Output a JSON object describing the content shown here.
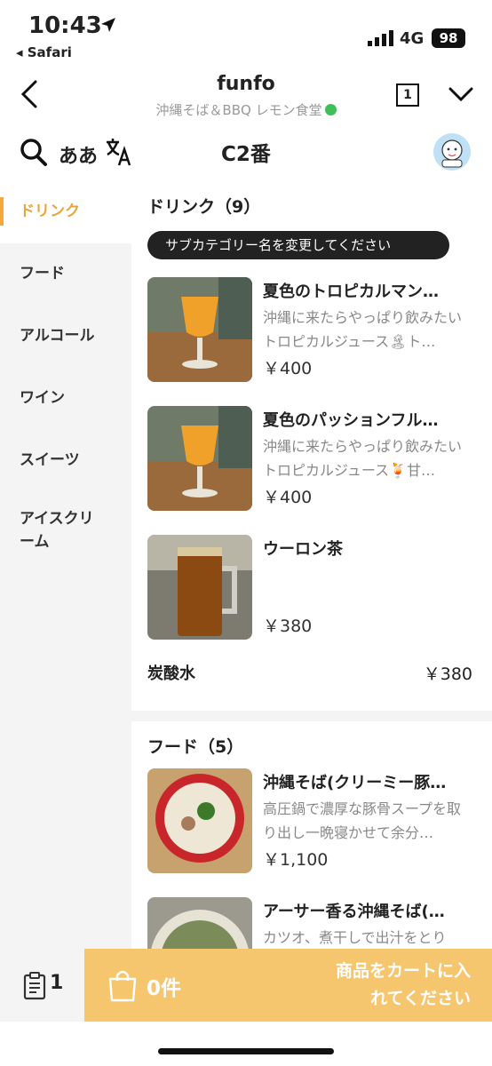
{
  "status": {
    "time": "10:43",
    "back_app": "◂ Safari",
    "network": "4G",
    "battery": "98"
  },
  "header": {
    "title": "funfo",
    "subtitle": "沖縄そば＆BBQ レモン食堂",
    "tab_count": "1"
  },
  "toolbar": {
    "kana_label": "ああ",
    "table_name": "C2番"
  },
  "sidebar": {
    "items": [
      {
        "label": "ドリンク"
      },
      {
        "label": "フード"
      },
      {
        "label": "アルコール"
      },
      {
        "label": "ワイン"
      },
      {
        "label": "スイーツ"
      },
      {
        "label": "アイスクリーム"
      }
    ]
  },
  "drinks": {
    "title": "ドリンク（9）",
    "subcategory_pill": "サブカテゴリー名を変更してください",
    "items": [
      {
        "name": "夏色のトロピカルマン…",
        "desc": "沖縄に来たらやっぱり飲みたいトロピカルジュース🏝ト…",
        "price": "￥400"
      },
      {
        "name": "夏色のパッションフル…",
        "desc": "沖縄に来たらやっぱり飲みたいトロピカルジュース🍹甘…",
        "price": "￥400"
      },
      {
        "name": "ウーロン茶",
        "desc": "",
        "price": "￥380"
      }
    ],
    "plain_item": {
      "name": "炭酸水",
      "price": "￥380"
    }
  },
  "food": {
    "title": "フード（5）",
    "items": [
      {
        "name": "沖縄そば(クリーミー豚…",
        "desc": "高圧鍋で濃厚な豚骨スープを取り出し一晩寝かせて余分…",
        "price": "￥1,100"
      },
      {
        "name": "アーサー香る沖縄そば(…",
        "desc": "カツオ、煮干しで出汁をとり",
        "price": ""
      }
    ]
  },
  "bottom": {
    "order_count": "1",
    "cart_count": "0件",
    "cart_message": "商品をカートに入れてください"
  },
  "colors": {
    "accent": "#f3a93b",
    "cart_bg": "#f6c66e",
    "sidebar_bg": "#f4f4f4"
  }
}
